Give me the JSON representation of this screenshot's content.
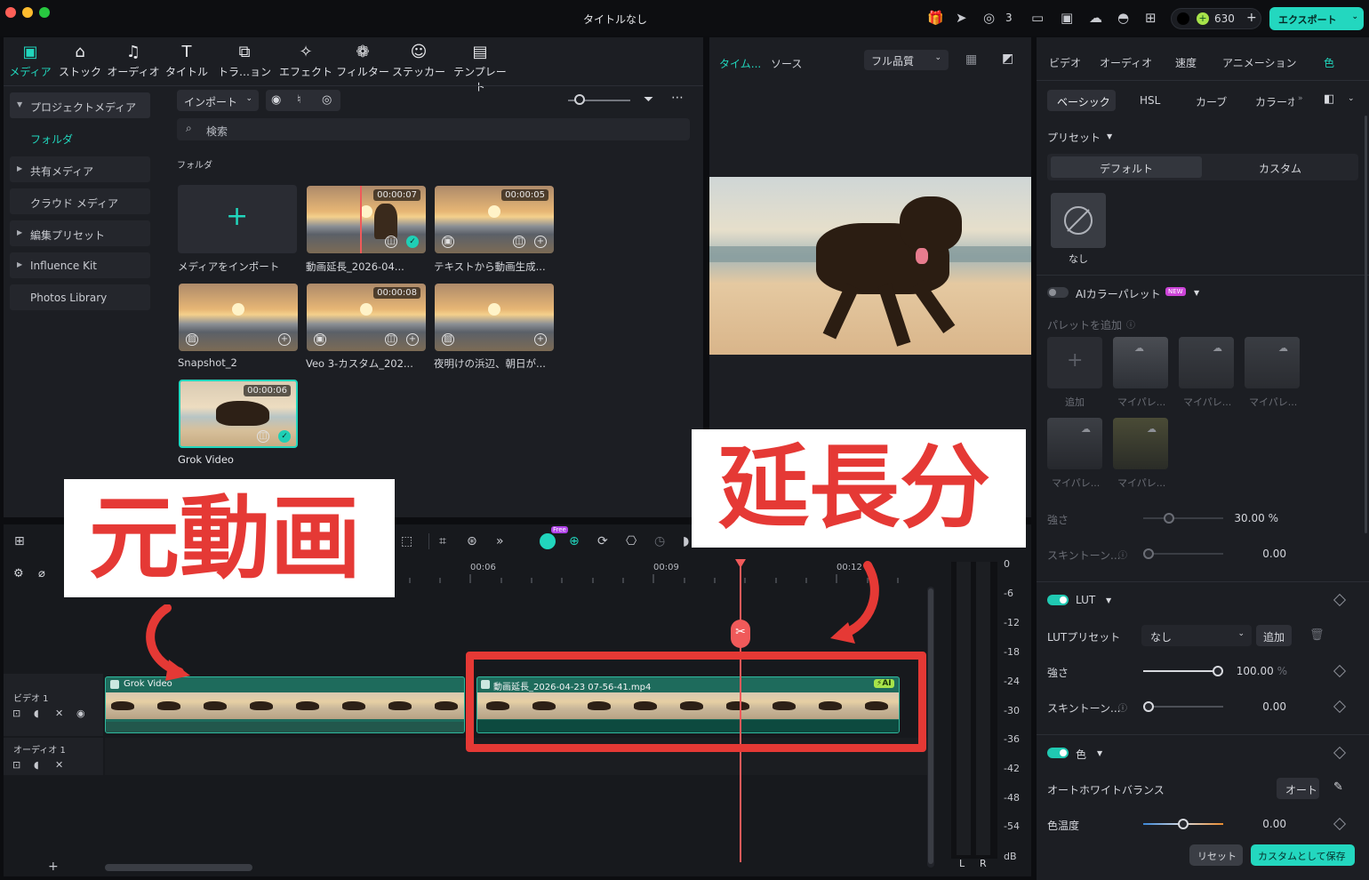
{
  "window": {
    "title": "タイトルなし",
    "credit_count": "3",
    "credits": "630",
    "export_label": "エクスポート"
  },
  "toolbar": {
    "items": [
      {
        "label": "メディア",
        "icon": "media-icon"
      },
      {
        "label": "ストック",
        "icon": "stock-icon"
      },
      {
        "label": "オーディオ",
        "icon": "audio-icon"
      },
      {
        "label": "タイトル",
        "icon": "title-icon"
      },
      {
        "label": "トラ…ョン",
        "icon": "transition-icon"
      },
      {
        "label": "エフェクト",
        "icon": "effect-icon"
      },
      {
        "label": "フィルター",
        "icon": "filter-icon"
      },
      {
        "label": "ステッカー",
        "icon": "sticker-icon"
      },
      {
        "label": "テンプレート",
        "icon": "template-icon"
      }
    ]
  },
  "sidebar": {
    "project_media": "プロジェクトメディア",
    "folder": "フォルダ",
    "items": [
      "共有メディア",
      "クラウド メディア",
      "編集プリセット",
      "Influence Kit",
      "Photos Library"
    ]
  },
  "media": {
    "import_label": "インポート",
    "search_placeholder": "検索",
    "section_label": "フォルダ",
    "import_tile_label": "メディアをインポート",
    "items": [
      {
        "label": "動画延長_2026-04...",
        "duration": "00:00:07"
      },
      {
        "label": "テキストから動画生成...",
        "duration": "00:00:05"
      },
      {
        "label": "Snapshot_2",
        "duration": ""
      },
      {
        "label": "Veo 3-カスタム_202...",
        "duration": "00:00:08"
      },
      {
        "label": "夜明けの浜辺、朝日が...",
        "duration": ""
      },
      {
        "label": "Grok Video",
        "duration": "00:00:06"
      }
    ]
  },
  "preview": {
    "tab_timeline": "タイム...",
    "tab_source": "ソース",
    "quality": "フル品質"
  },
  "inspector": {
    "tabs": [
      "ビデオ",
      "オーディオ",
      "速度",
      "アニメーション",
      "色"
    ],
    "subtabs": [
      "ベーシック",
      "HSL",
      "カーブ",
      "カラーホ"
    ],
    "preset_label": "プリセット",
    "preset_default": "デフォルト",
    "preset_custom": "カスタム",
    "none_label": "なし",
    "ai_palette_label": "AIカラーパレット",
    "new_badge": "NEW",
    "add_palette_label": "パレットを追加",
    "palette_add": "追加",
    "palette_items": [
      "マイパレ...",
      "マイパレ...",
      "マイパレ...",
      "マイパレ...",
      "マイパレ..."
    ],
    "strength_label": "強さ",
    "strength_value": "30.00",
    "strength_level": 0.3,
    "skin_label": "スキントーン...",
    "skin_value": "0.00",
    "percent": "%",
    "lut_label": "LUT",
    "lut_preset_label": "LUTプリセット",
    "lut_preset_value": "なし",
    "lut_add": "追加",
    "lut_strength_value": "100.00",
    "lut_strength_level": 1.0,
    "lut_skin_value": "0.00",
    "color_label": "色",
    "auto_wb_label": "オートホワイトバランス",
    "auto_label": "オート",
    "temp_label": "色温度",
    "temp_value": "0.00",
    "reset_label": "リセット",
    "save_custom_label": "カスタムとして保存"
  },
  "timeline": {
    "ruler": [
      "00:06",
      "00:09",
      "00:12"
    ],
    "video_track": "ビデオ 1",
    "audio_track": "オーディオ 1",
    "clip1_name": "Grok Video",
    "clip2_name": "動画延長_2026-04-23 07-56-41.mp4",
    "ai_badge": "AI",
    "free_badge": "Free",
    "meter_scale": [
      "0",
      "-6",
      "-12",
      "-18",
      "-24",
      "-30",
      "-36",
      "-42",
      "-48",
      "-54",
      "dB"
    ],
    "meter_l": "L",
    "meter_r": "R"
  },
  "annotations": {
    "original": "元動画",
    "extension": "延長分"
  },
  "colors": {
    "accent": "#21d6bd",
    "callout_red": "#e53935",
    "playhead": "#f05a5a"
  }
}
